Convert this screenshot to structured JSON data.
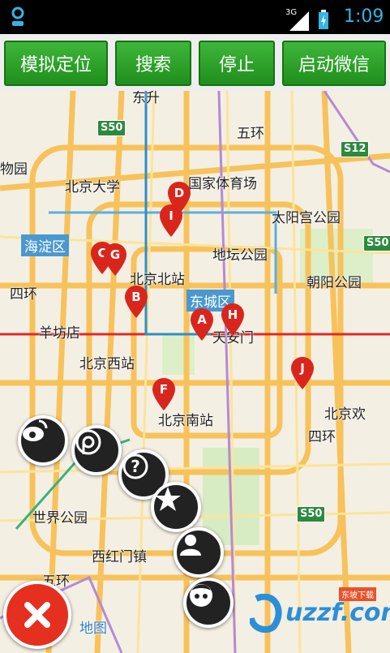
{
  "status_bar": {
    "network": "3G",
    "time": "1:09"
  },
  "toolbar": {
    "buttons": [
      {
        "label": "模拟定位"
      },
      {
        "label": "搜索"
      },
      {
        "label": "停止"
      },
      {
        "label": "启动微信"
      }
    ]
  },
  "map": {
    "labels": [
      "东升",
      "五环",
      "S12",
      "物园",
      "北京大学",
      "国家体育场",
      "太阳宫公园",
      "海淀区",
      "地坛公园",
      "S50",
      "北京北站",
      "朝阳公园",
      "东城区",
      "四环",
      "羊坊店",
      "天安门",
      "北京西站",
      "北京南站",
      "北京欢",
      "四环",
      "世界公园",
      "S50",
      "西红门镇",
      "五环",
      "地图"
    ],
    "shields": [
      "S50",
      "S12",
      "S50",
      "S50"
    ],
    "districts": [
      "海淀区",
      "东城区"
    ],
    "markers": [
      "D",
      "I",
      "C",
      "G",
      "B",
      "A",
      "H",
      "F",
      "J"
    ],
    "watermark": "uzzf.com",
    "watermark_sub": "东坡下载"
  },
  "actions": [
    "weibo-icon",
    "wechat-moments-icon",
    "help-icon",
    "star-icon",
    "user-icon",
    "avatar-icon"
  ],
  "colors": {
    "button_green": "#2ea82b",
    "marker_red": "#d9261c",
    "accent_blue": "#33b5e5"
  }
}
